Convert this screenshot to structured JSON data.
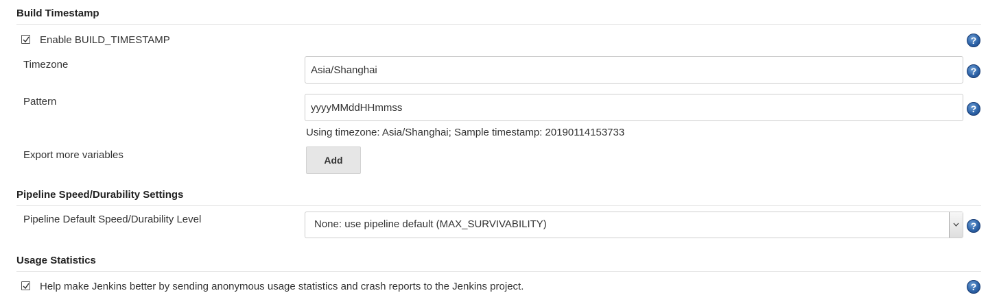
{
  "build_timestamp": {
    "title": "Build Timestamp",
    "enable_label": "Enable BUILD_TIMESTAMP",
    "enabled": true,
    "timezone_label": "Timezone",
    "timezone_value": "Asia/Shanghai",
    "pattern_label": "Pattern",
    "pattern_value": "yyyyMMddHHmmss",
    "sample_hint": "Using timezone: Asia/Shanghai; Sample timestamp: 20190114153733",
    "export_label": "Export more variables",
    "add_button": "Add"
  },
  "pipeline": {
    "title": "Pipeline Speed/Durability Settings",
    "level_label": "Pipeline Default Speed/Durability Level",
    "level_value": "None: use pipeline default (MAX_SURVIVABILITY)"
  },
  "usage": {
    "title": "Usage Statistics",
    "help_label": "Help make Jenkins better by sending anonymous usage statistics and crash reports to the Jenkins project.",
    "enabled": true
  },
  "help_icon_glyph": "?",
  "colors": {
    "help_icon": "#2e64a8",
    "button_bg": "#e6e6e6",
    "border": "#cccccc"
  }
}
